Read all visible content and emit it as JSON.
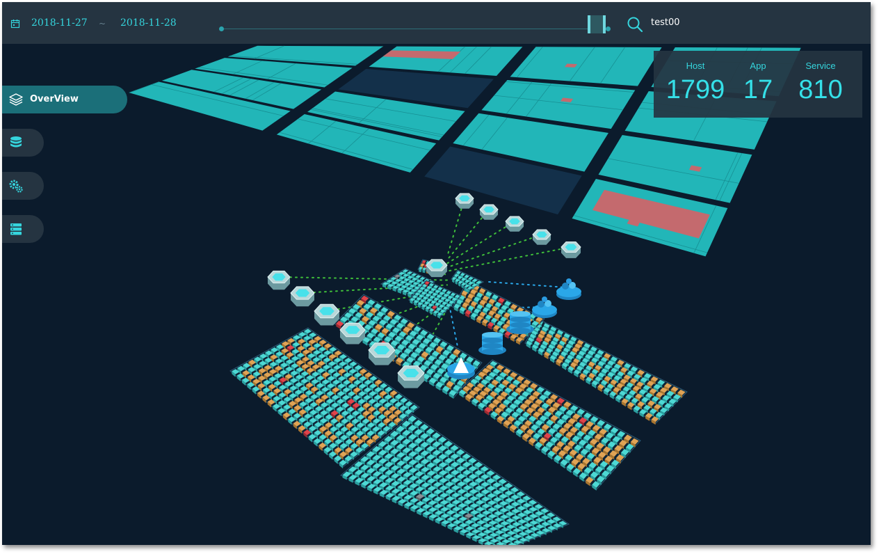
{
  "header": {
    "date_start": "2018-11-27",
    "date_separator": "~",
    "date_end": "2018-11-28",
    "search_value": "test00",
    "icons": {
      "calendar": "calendar-icon",
      "search": "search-icon"
    }
  },
  "stats": [
    {
      "label": "Host",
      "value": "1799"
    },
    {
      "label": "App",
      "value": "17"
    },
    {
      "label": "Service",
      "value": "810"
    }
  ],
  "sidebar": {
    "items": [
      {
        "label": "OverView",
        "icon": "layers-icon",
        "active": true
      },
      {
        "label": "",
        "icon": "database-icon",
        "active": false
      },
      {
        "label": "",
        "icon": "gears-icon",
        "active": false
      },
      {
        "label": "",
        "icon": "server-icon",
        "active": false
      }
    ]
  },
  "colors": {
    "background": "#0b1b2c",
    "bar": "#253441",
    "accent": "#35d5dd",
    "tile_normal": "#22b6b8",
    "tile_alert": "#c46a6e",
    "cube_normal": "#4dd8d4",
    "cube_warning": "#e0a355",
    "cube_error": "#e0434a",
    "node_blue": "#2aa7e8"
  }
}
